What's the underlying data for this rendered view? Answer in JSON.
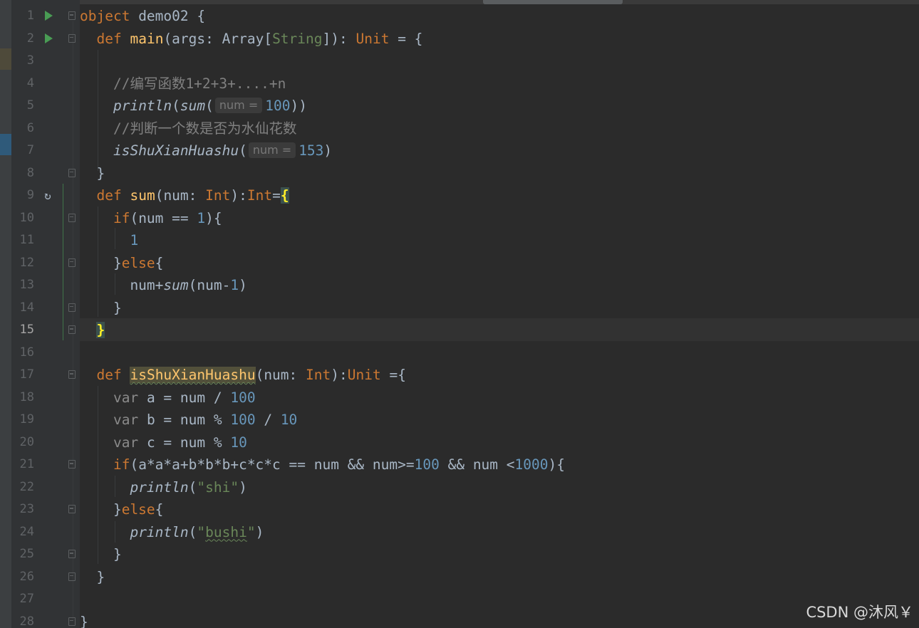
{
  "editor": {
    "current_line": 15,
    "lines": [
      {
        "n": "1",
        "text": "object demo02 {"
      },
      {
        "n": "2",
        "text": "def main(args: Array[String]): Unit = {"
      },
      {
        "n": "3",
        "text": ""
      },
      {
        "n": "4",
        "text": "//编写函数1+2+3+....+n"
      },
      {
        "n": "5",
        "text": "println(sum( num = 100))"
      },
      {
        "n": "6",
        "text": "//判断一个数是否为水仙花数"
      },
      {
        "n": "7",
        "text": "isShuXianHuashu( num = 153)"
      },
      {
        "n": "8",
        "text": "}"
      },
      {
        "n": "9",
        "text": "def sum(num: Int):Int={"
      },
      {
        "n": "10",
        "text": "if(num == 1){"
      },
      {
        "n": "11",
        "text": "1"
      },
      {
        "n": "12",
        "text": "}else{"
      },
      {
        "n": "13",
        "text": "num+sum(num-1)"
      },
      {
        "n": "14",
        "text": "}"
      },
      {
        "n": "15",
        "text": "}"
      },
      {
        "n": "16",
        "text": ""
      },
      {
        "n": "17",
        "text": "def isShuXianHuashu(num: Int):Unit ={"
      },
      {
        "n": "18",
        "text": "var a = num / 100"
      },
      {
        "n": "19",
        "text": "var b = num % 100 / 10"
      },
      {
        "n": "20",
        "text": "var c = num % 10"
      },
      {
        "n": "21",
        "text": "if(a*a*a+b*b*b+c*c*c == num && num>=100 && num <1000){"
      },
      {
        "n": "22",
        "text": "println(\"shi\")"
      },
      {
        "n": "23",
        "text": "}else{"
      },
      {
        "n": "24",
        "text": "println(\"bushi\")"
      },
      {
        "n": "25",
        "text": "}"
      },
      {
        "n": "26",
        "text": "}"
      },
      {
        "n": "27",
        "text": ""
      },
      {
        "n": "28",
        "text": "}"
      }
    ],
    "hints": {
      "sum_param": "num =",
      "shuxian_param": "num ="
    }
  },
  "watermark": "CSDN @沐风￥",
  "colors": {
    "background": "#2b2b2b",
    "keyword": "#cc7832",
    "function": "#ffc66d",
    "number": "#6897bb",
    "string": "#6a8759",
    "comment": "#808080",
    "run_icon": "#499c54"
  },
  "icons": {
    "run": "run-gutter-icon",
    "recursion": "recursive-call-icon",
    "fold": "fold-marker-icon"
  }
}
